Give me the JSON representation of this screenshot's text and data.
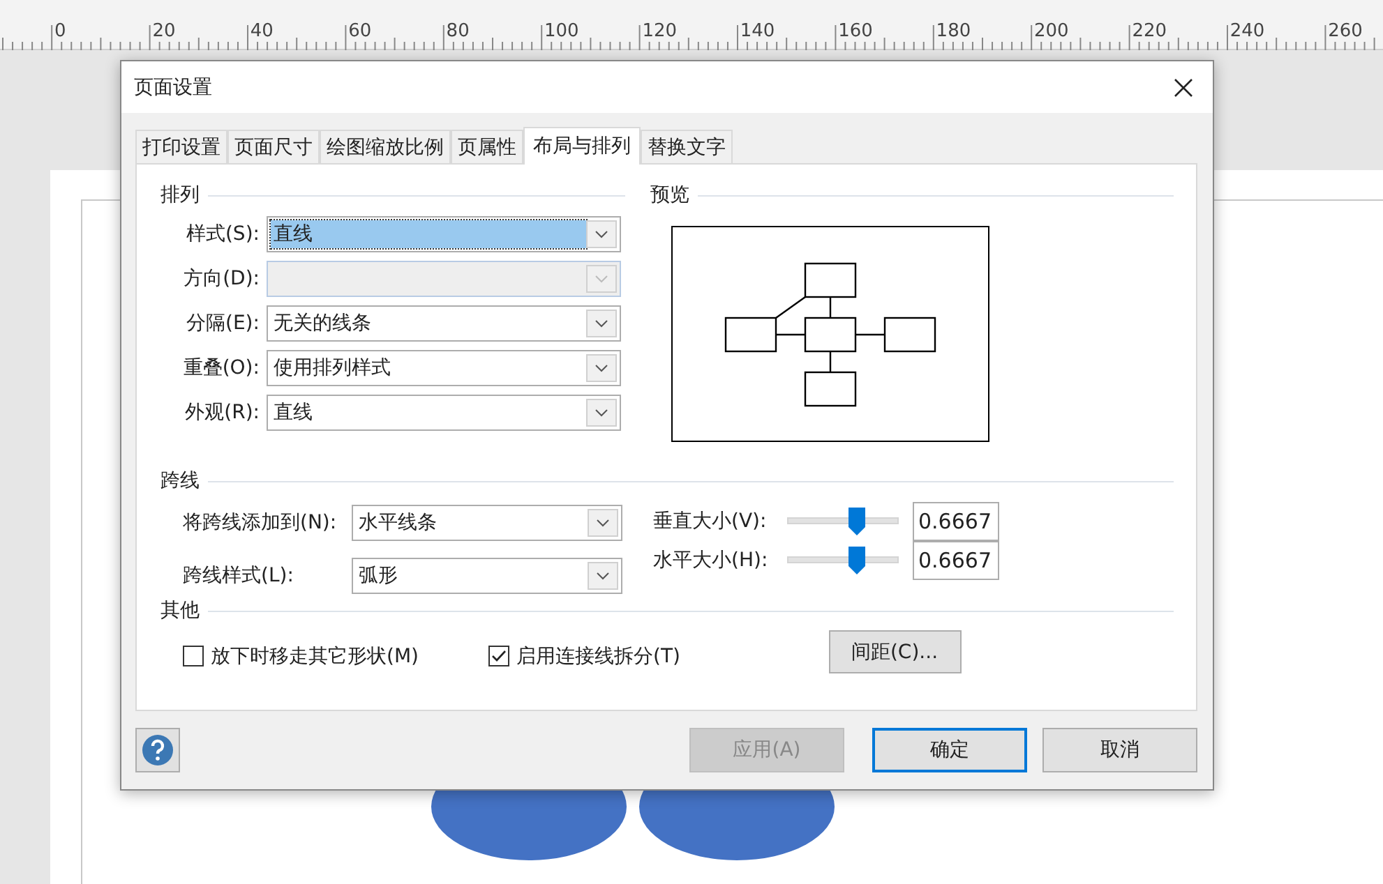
{
  "ruler": {
    "labels": [
      "0",
      "20",
      "40",
      "60",
      "80",
      "100",
      "120",
      "140",
      "160",
      "180",
      "200",
      "220",
      "240",
      "260"
    ]
  },
  "dialog": {
    "title": "页面设置",
    "tabs": [
      {
        "label": "打印设置",
        "selected": false
      },
      {
        "label": "页面尺寸",
        "selected": false
      },
      {
        "label": "绘图缩放比例",
        "selected": false
      },
      {
        "label": "页属性",
        "selected": false
      },
      {
        "label": "布局与排列",
        "selected": true
      },
      {
        "label": "替换文字",
        "selected": false
      }
    ],
    "arrange": {
      "title": "排列",
      "fields": [
        {
          "label": "样式(S):",
          "value": "直线",
          "disabled": false,
          "highlighted": true
        },
        {
          "label": "方向(D):",
          "disabled": true,
          "highlighted": false
        },
        {
          "label": "分隔(E):",
          "value": "无关的线条",
          "disabled": false,
          "highlighted": false
        },
        {
          "label": "重叠(O):",
          "value": "使用排列样式",
          "disabled": false,
          "highlighted": false
        },
        {
          "label": "外观(R):",
          "value": "直线",
          "disabled": false,
          "highlighted": false
        }
      ]
    },
    "preview": {
      "title": "预览"
    },
    "jumps": {
      "title": "跨线",
      "fields": [
        {
          "label": "将跨线添加到(N):",
          "value": "水平线条"
        },
        {
          "label": "跨线样式(L):",
          "value": "弧形"
        }
      ],
      "sizes": [
        {
          "label": "垂直大小(V):",
          "level": 0.62,
          "value": "0.6667"
        },
        {
          "label": "水平大小(H):",
          "level": 0.62,
          "value": "0.6667"
        }
      ]
    },
    "other": {
      "title": "其他",
      "checkboxes": [
        {
          "label": "放下时移走其它形状(M)",
          "checked": false
        },
        {
          "label": "启用连接线拆分(T)",
          "checked": true
        }
      ],
      "spacing_button": "间距(C)..."
    },
    "buttons": [
      {
        "label": "应用(A)",
        "disabled": true,
        "default": false
      },
      {
        "label": "确定",
        "disabled": false,
        "default": true
      },
      {
        "label": "取消",
        "disabled": false,
        "default": false
      }
    ]
  }
}
